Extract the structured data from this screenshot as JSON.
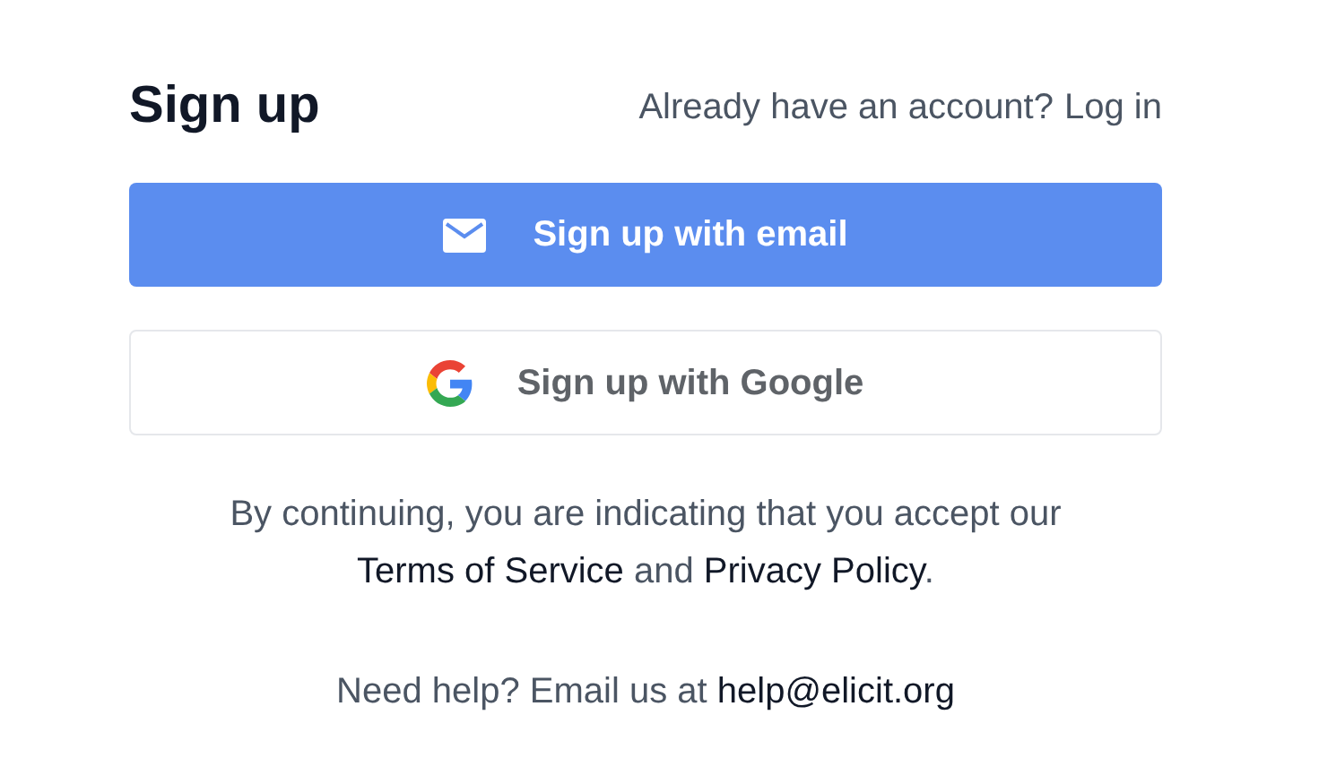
{
  "title": "Sign up",
  "login_prompt": {
    "text": "Already have an account?",
    "link": "Log in"
  },
  "buttons": [
    {
      "kind": "email",
      "label": "Sign up with email"
    },
    {
      "kind": "google",
      "label": "Sign up with Google"
    }
  ],
  "legal": {
    "before": "By continuing, you are indicating that you accept our",
    "terms": "Terms of Service",
    "middle": "and",
    "privacy": "Privacy Policy",
    "after": "."
  },
  "help": {
    "text": "Need help? Email us at",
    "email": "help@elicit.org"
  }
}
